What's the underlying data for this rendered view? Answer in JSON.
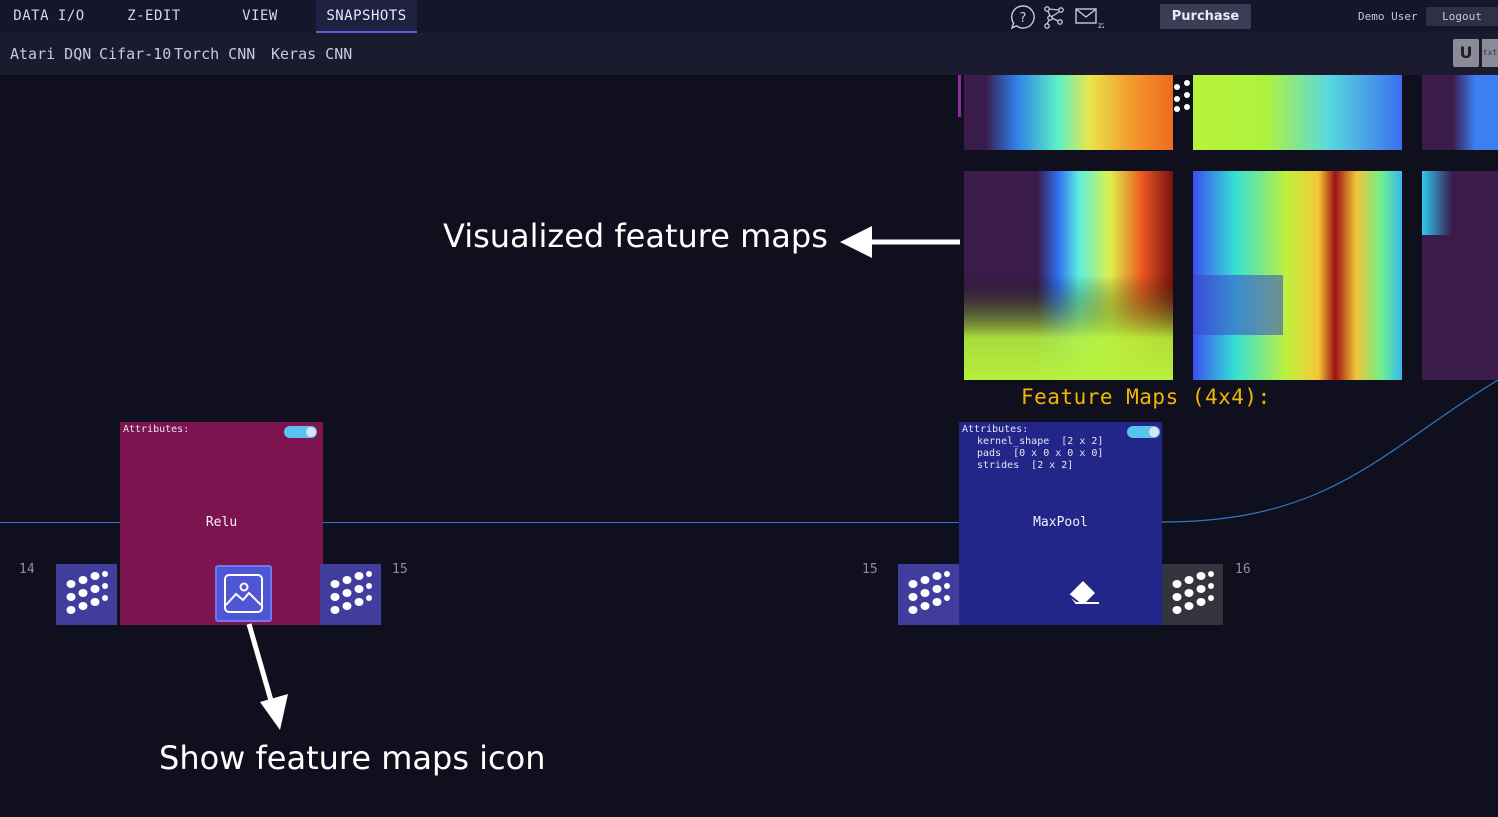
{
  "topbar": {
    "tabs": [
      {
        "label": "DATA I/O"
      },
      {
        "label": "Z-EDIT"
      },
      {
        "label": "VIEW"
      },
      {
        "label": "SNAPSHOTS"
      }
    ],
    "icons": [
      "help-bubble-icon",
      "network-graph-icon",
      "mail-icon"
    ],
    "purchase_label": "Purchase",
    "user_name": "Demo User",
    "logout_label": "Logout"
  },
  "subbar": {
    "tabs": [
      {
        "label": "Atari DQN"
      },
      {
        "label": "Cifar-10"
      },
      {
        "label": "Torch CNN"
      },
      {
        "label": "Keras CNN"
      }
    ],
    "u_label": "U",
    "txt_label": "txt"
  },
  "feature_maps": {
    "title": "Feature Maps (4x4):"
  },
  "layers": {
    "relu": {
      "attributes_label": "Attributes:",
      "name": "Relu",
      "input_port_number": "14",
      "output_port_number": "15"
    },
    "maxpool": {
      "attributes_label": "Attributes:",
      "attribute_lines": [
        "kernel_shape  [2 x 2]",
        "pads  [0 x 0 x 0 x 0]",
        "strides  [2 x 2]"
      ],
      "name": "MaxPool",
      "input_port_number": "15",
      "output_port_number": "16"
    }
  },
  "annotations": {
    "visualized": "Visualized feature maps",
    "show_icon": "Show feature maps icon"
  },
  "colors": {
    "relu_card": "#7d1450",
    "maxpool_card": "#232689",
    "wire": "#2f78c9",
    "feature_map_title": "#f0b800"
  }
}
